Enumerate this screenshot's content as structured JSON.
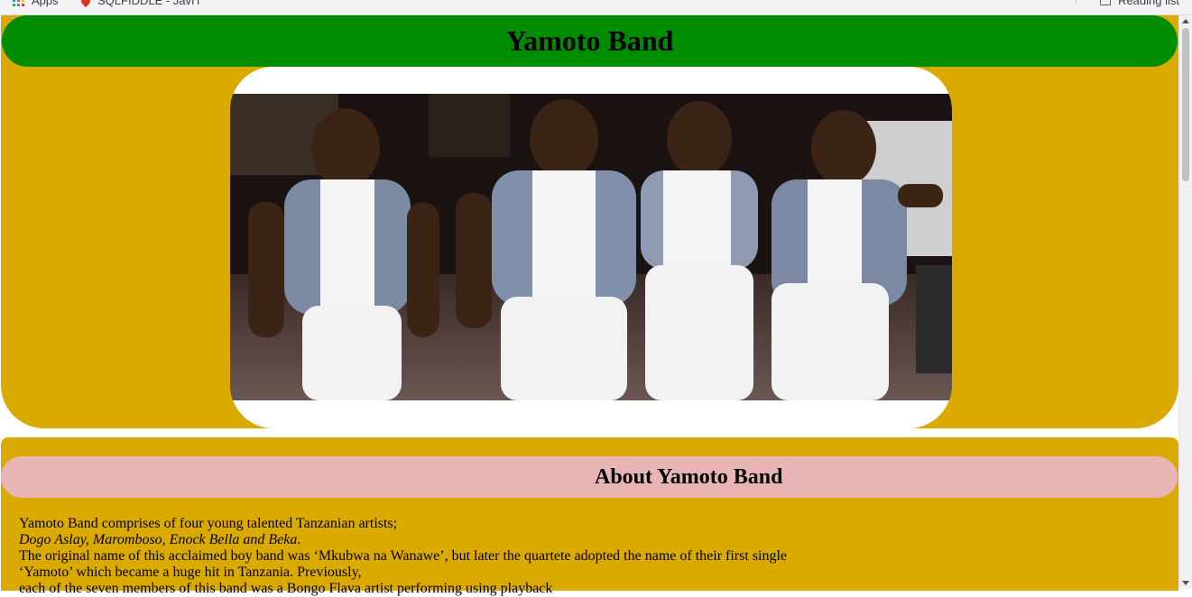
{
  "browser": {
    "bookmarks": {
      "apps_label": "Apps",
      "bookmark_1_label": "SQLFIDDLE - JavIT",
      "reading_list_label": "Reading list"
    }
  },
  "header": {
    "title": "Yamoto Band"
  },
  "hero": {
    "image_alt": "Yamoto Band members"
  },
  "about": {
    "title": "About Yamoto Band",
    "line1": "Yamoto Band comprises of four young talented Tanzanian artists;",
    "members": "Dogo Aslay, Maromboso, Enock Bella and Beka",
    "line3": "The original name of this acclaimed boy band was ‘Mkubwa na Wanawe’, but later the quartete adopted the name of their first single",
    "line4": "‘Yamoto’ which became a huge hit in Tanzania. Previously,",
    "line5": "each of the seven members of this band was a Bongo Flava artist performing using playback"
  },
  "colors": {
    "header_bg": "#008c00",
    "hero_bg": "#dbaa00",
    "about_header_bg": "#e8b4b4"
  }
}
